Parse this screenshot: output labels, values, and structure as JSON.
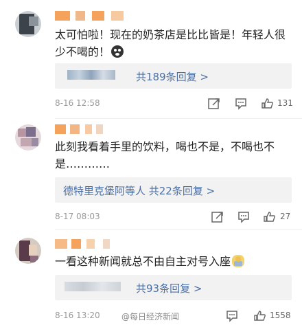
{
  "comments": [
    {
      "text": "太可怕啦！现在的奶茶店是比比皆是！年轻人很少不喝的！",
      "replies_label": "共189条回复 >",
      "time": "8-16 12:58",
      "likes": "131"
    },
    {
      "text": "此刻我看着手里的饮料，喝也不是，不喝也不是…………",
      "replies_label": "德特里克堡阿等人 共22条回复 >",
      "time": "8-17 08:03",
      "likes": "27"
    },
    {
      "text": "一看这种新闻就总不由自主对号入座",
      "replies_label": "共93条回复 >",
      "time": "8-16 13:20",
      "likes": "1558"
    }
  ],
  "watermark": "@每日经济新闻",
  "colors": {
    "link": "#4a6fa5",
    "meta": "#999999",
    "accent_orange": "#f5a25d"
  },
  "icons": [
    "share-icon",
    "comment-icon",
    "like-icon"
  ]
}
